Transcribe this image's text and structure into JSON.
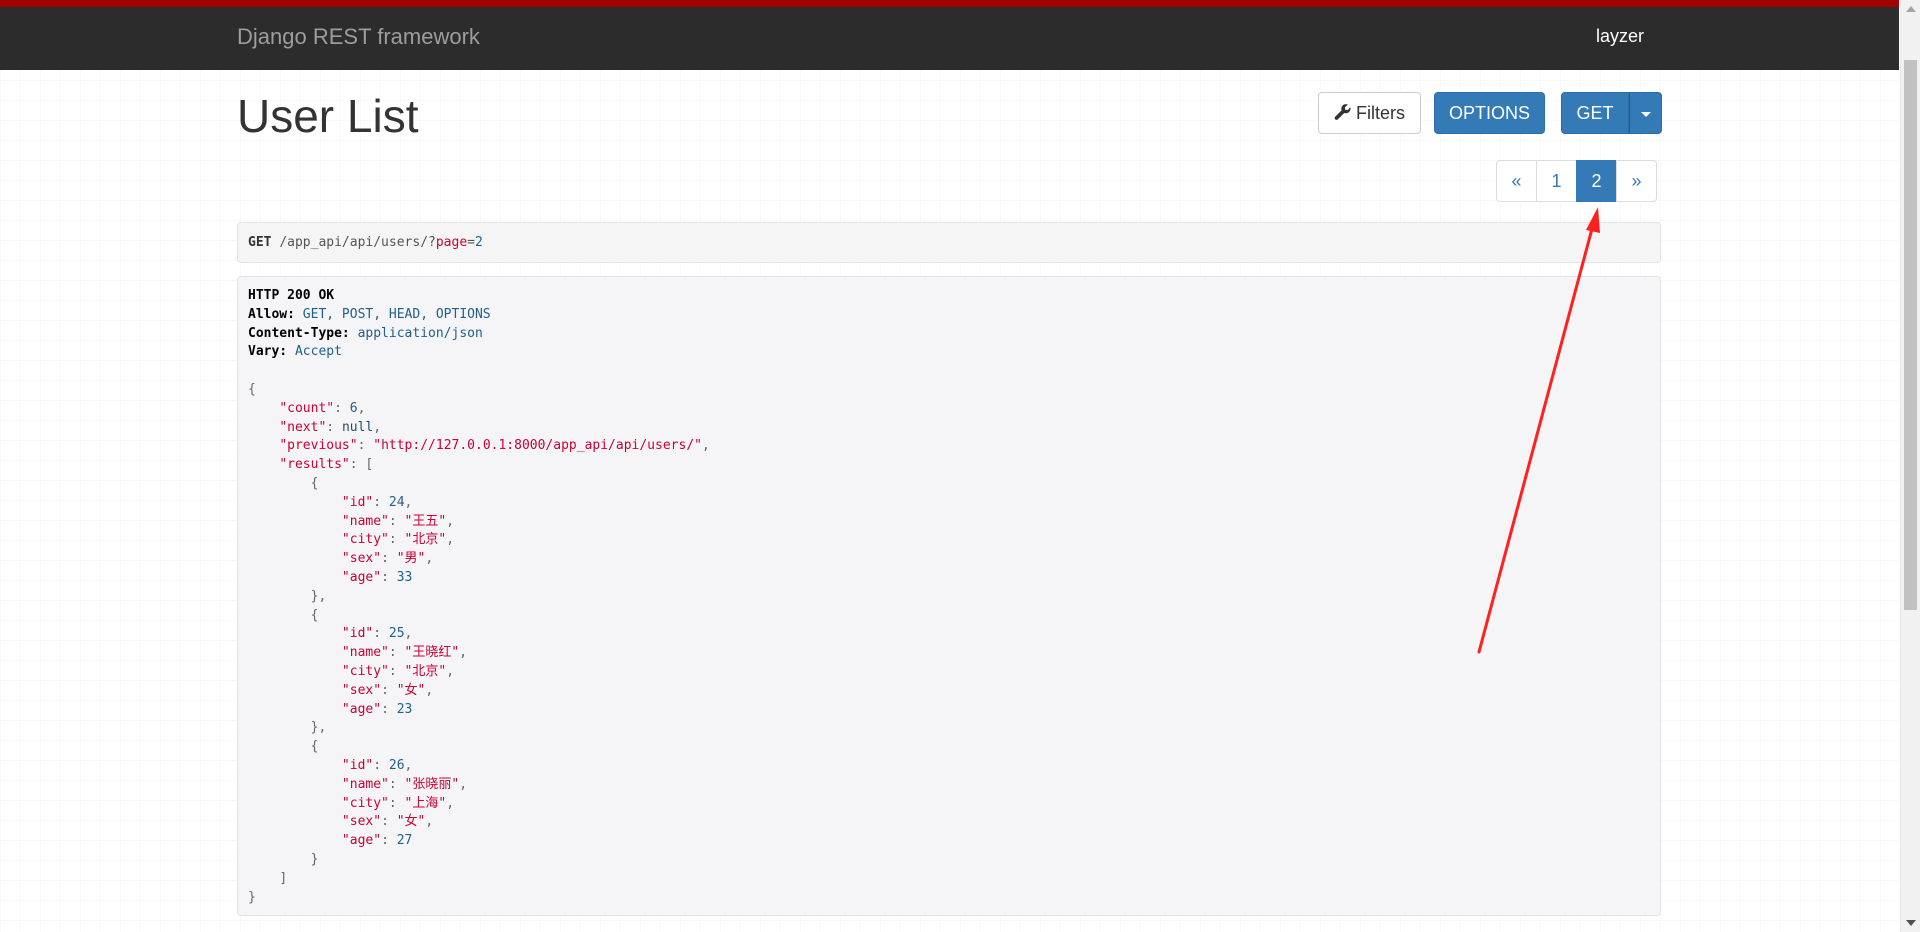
{
  "navbar": {
    "brand": "Django REST framework",
    "user": "layzer",
    "accent_color": "#a30000",
    "background_color": "#2c2c2c"
  },
  "page": {
    "title": "User List"
  },
  "toolbar": {
    "filters_label": "Filters",
    "filters_icon": "wrench-icon",
    "options_label": "OPTIONS",
    "get_label": "GET",
    "primary_color": "#337ab7"
  },
  "pagination": {
    "prev": "«",
    "pages": [
      "1",
      "2"
    ],
    "active": "2",
    "next": "»"
  },
  "request": {
    "method": "GET",
    "path_prefix": "/app_api/api/users/?",
    "query_key": "page",
    "query_eq": "=",
    "query_value": "2"
  },
  "response": {
    "status": "HTTP 200 OK",
    "headers": [
      {
        "name": "Allow:",
        "value": "GET, POST, HEAD, OPTIONS"
      },
      {
        "name": "Content-Type:",
        "value": "application/json"
      },
      {
        "name": "Vary:",
        "value": "Accept"
      }
    ],
    "body": {
      "count": "6",
      "next": "null",
      "previous": "\"http://127.0.0.1:8000/app_api/api/users/\"",
      "results": [
        {
          "id": "24",
          "name": "\"王五\"",
          "city": "\"北京\"",
          "sex": "\"男\"",
          "age": "33"
        },
        {
          "id": "25",
          "name": "\"王晓红\"",
          "city": "\"北京\"",
          "sex": "\"女\"",
          "age": "23"
        },
        {
          "id": "26",
          "name": "\"张晓丽\"",
          "city": "\"上海\"",
          "sex": "\"女\"",
          "age": "27"
        }
      ]
    }
  },
  "annotation": {
    "arrow_color": "#ff2020"
  }
}
